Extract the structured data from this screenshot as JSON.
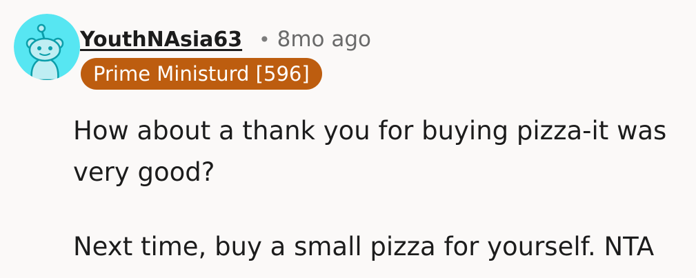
{
  "comment": {
    "author": {
      "username": "YouthNAsia63",
      "avatar_icon": "reddit-snoo-avatar-icon",
      "avatar_color": "#57e6f2"
    },
    "separator": "•",
    "timestamp": "8mo ago",
    "flair": {
      "label": "Prime Ministurd [596]",
      "color": "#bd5d0f"
    },
    "paragraphs": [
      "How about a thank you for buying pizza-it was very good?",
      "Next time, buy a small pizza for yourself. NTA"
    ]
  }
}
